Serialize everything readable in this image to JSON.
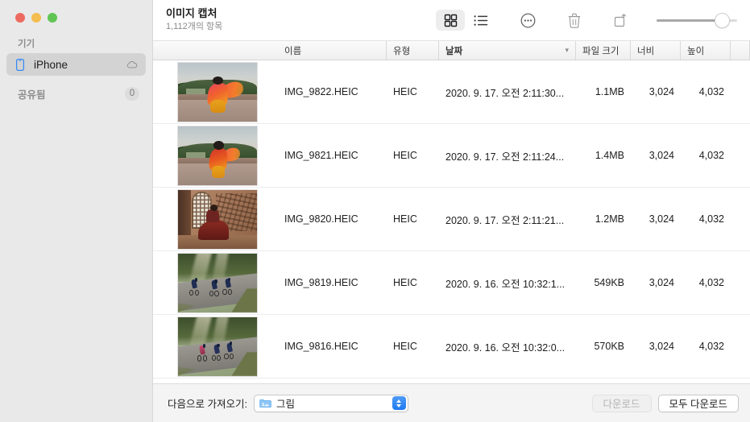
{
  "window": {
    "traffic_lights": [
      {
        "name": "close",
        "color": "#ec6a5f"
      },
      {
        "name": "minimize",
        "color": "#f4bd4f"
      },
      {
        "name": "maximize",
        "color": "#61c554"
      }
    ]
  },
  "sidebar": {
    "sections": [
      {
        "header": "기기",
        "items": [
          {
            "label": "iPhone",
            "icon": "iphone-icon",
            "accessory_icon": "cloud-icon",
            "selected": true
          }
        ]
      },
      {
        "header": "공유됨",
        "badge": "0"
      }
    ]
  },
  "toolbar": {
    "title": "이미지 캡처",
    "subtitle": "1,112개의 항목",
    "buttons": [
      {
        "name": "grid-view-button",
        "icon": "grid-icon",
        "active": true
      },
      {
        "name": "list-view-button",
        "icon": "list-icon",
        "active": false
      },
      {
        "name": "more-options-button",
        "icon": "ellipsis-circle-icon",
        "active": false
      },
      {
        "name": "delete-button",
        "icon": "trash-icon",
        "active": false
      },
      {
        "name": "rotate-button",
        "icon": "rotate-icon",
        "active": false
      }
    ],
    "zoom_slider": {
      "value": 78
    }
  },
  "columns": [
    {
      "key": "thumbnail",
      "label": ""
    },
    {
      "key": "name",
      "label": "이름",
      "sorted": false
    },
    {
      "key": "type",
      "label": "유형",
      "sorted": false
    },
    {
      "key": "date",
      "label": "날짜",
      "sorted": true,
      "sort_direction": "descending"
    },
    {
      "key": "size",
      "label": "파일 크기",
      "sorted": false
    },
    {
      "key": "width",
      "label": "너비",
      "sorted": false
    },
    {
      "key": "height",
      "label": "높이",
      "sorted": false
    }
  ],
  "rows": [
    {
      "thumbnail": "woman-in-pink-sari-at-fort",
      "name": "IMG_9822.HEIC",
      "type": "HEIC",
      "date": "2020. 9. 17. 오전 2:11:30...",
      "size": "1.1MB",
      "width": "3,024",
      "height": "4,032"
    },
    {
      "thumbnail": "woman-in-orange-sari-at-fort",
      "name": "IMG_9821.HEIC",
      "type": "HEIC",
      "date": "2020. 9. 17. 오전 2:11:24...",
      "size": "1.4MB",
      "width": "3,024",
      "height": "4,032"
    },
    {
      "thumbnail": "woman-in-red-dress-by-lattice-window",
      "name": "IMG_9820.HEIC",
      "type": "HEIC",
      "date": "2020. 9. 17. 오전 2:11:21...",
      "size": "1.2MB",
      "width": "3,024",
      "height": "4,032"
    },
    {
      "thumbnail": "cyclists-on-misty-road",
      "name": "IMG_9819.HEIC",
      "type": "HEIC",
      "date": "2020. 9. 16. 오전 10:32:1...",
      "size": "549KB",
      "width": "3,024",
      "height": "4,032"
    },
    {
      "thumbnail": "cyclists-on-misty-road-2",
      "name": "IMG_9816.HEIC",
      "type": "HEIC",
      "date": "2020. 9. 16. 오전 10:32:0...",
      "size": "570KB",
      "width": "3,024",
      "height": "4,032"
    }
  ],
  "bottom_bar": {
    "import_label": "다음으로 가져오기:",
    "destination": "그림",
    "destination_icon": "blue-folder-icon",
    "download_button": "다운로드",
    "download_all_button": "모두 다운로드",
    "download_enabled": false,
    "download_all_enabled": true
  },
  "colors": {
    "sidebar_bg": "#e9e9e9",
    "selection_bg": "#d3d3d3",
    "accent_blue": "#1f7af0",
    "content_bg": "#ffffff",
    "bottom_bar_bg": "#f4f4f4"
  }
}
